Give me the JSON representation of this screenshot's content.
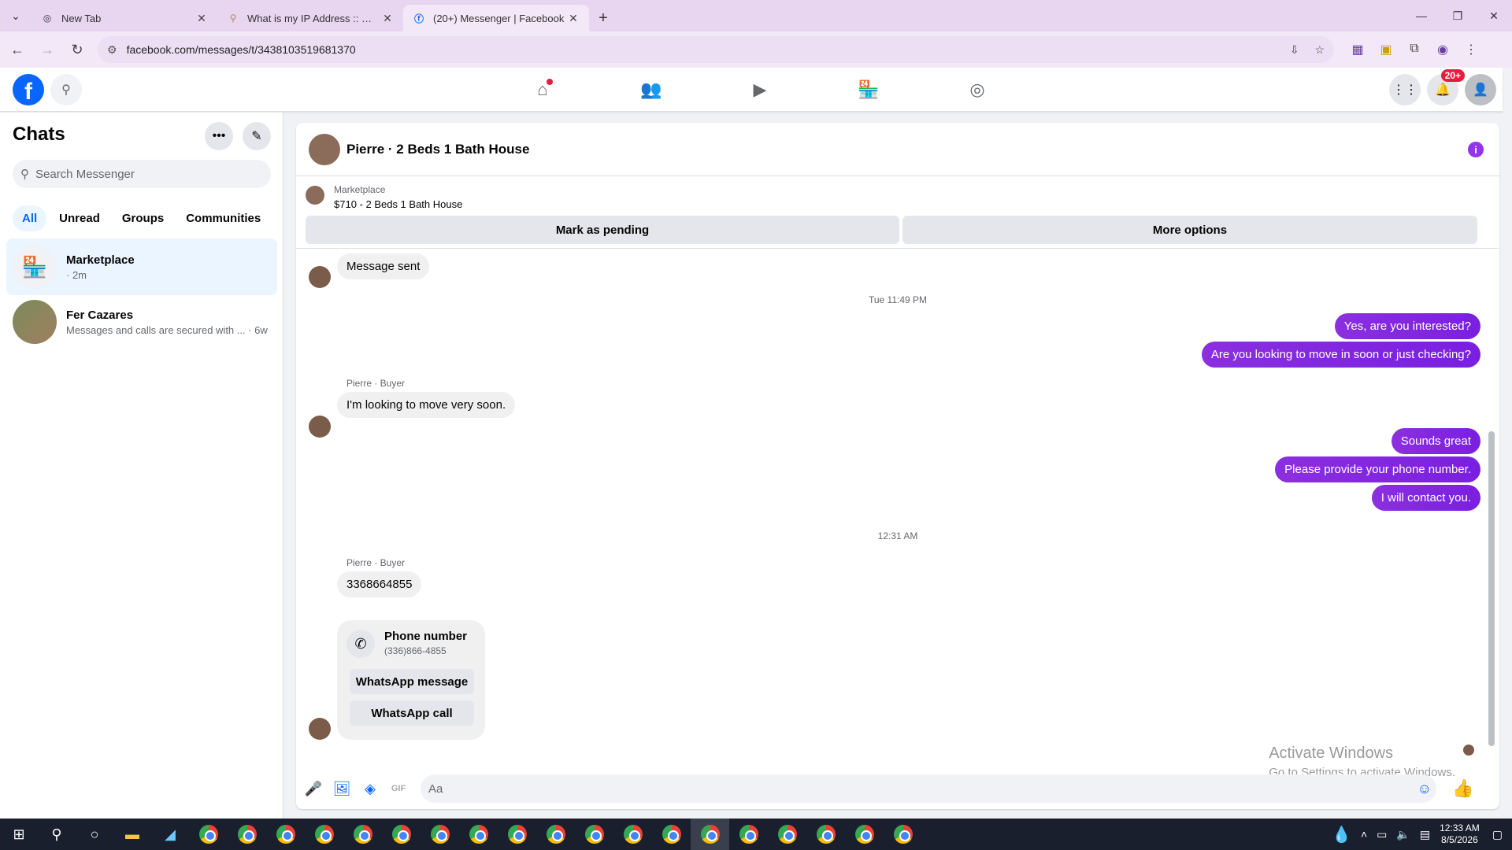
{
  "browser": {
    "tabs": [
      {
        "title": "New Tab",
        "icon": "chrome-icon"
      },
      {
        "title": "What is my IP Address :: WebBr",
        "icon": "webbrowser-icon"
      },
      {
        "title": "(20+) Messenger | Facebook",
        "icon": "facebook-icon"
      }
    ],
    "url": "facebook.com/messages/t/3438103519681370"
  },
  "fb": {
    "notification_badge": "20+",
    "nav_icons": [
      "home-icon",
      "friends-icon",
      "video-icon",
      "marketplace-icon",
      "groups-icon"
    ]
  },
  "sidebar": {
    "title": "Chats",
    "search_placeholder": "Search Messenger",
    "filters": [
      "All",
      "Unread",
      "Groups",
      "Communities"
    ],
    "chats": [
      {
        "name": "Marketplace",
        "subtitle": "· 2m"
      },
      {
        "name": "Fer Cazares",
        "subtitle": "Messages and calls are secured with ... · 6w"
      }
    ]
  },
  "conversation": {
    "title": "Pierre · 2 Beds 1 Bath House",
    "marketplace_label": "Marketplace",
    "listing": "$710 - 2 Beds 1 Bath House",
    "btn_pending": "Mark as pending",
    "btn_more": "More options",
    "messages": {
      "m1": "Message sent",
      "stamp1": "Tue 11:49 PM",
      "o1": "Yes, are you interested?",
      "o2": "Are you looking to move in soon or just checking?",
      "sender1": "Pierre · Buyer",
      "i2": "I'm looking to move very soon.",
      "o3": "Sounds great",
      "o4": "Please provide your phone number.",
      "o5": "I will contact you.",
      "stamp2": "12:31 AM",
      "sender2": "Pierre · Buyer",
      "i3": "3368664855"
    },
    "phone_card": {
      "title": "Phone number",
      "number": "(336)866-4855",
      "btn_whatsapp_msg": "WhatsApp message",
      "btn_whatsapp_call": "WhatsApp call"
    },
    "composer_placeholder": "Aa"
  },
  "watermark": {
    "line1": "Activate Windows",
    "line2": "Go to Settings to activate Windows."
  },
  "taskbar": {
    "time": "12:33 AM",
    "date": "8/5/2026"
  }
}
